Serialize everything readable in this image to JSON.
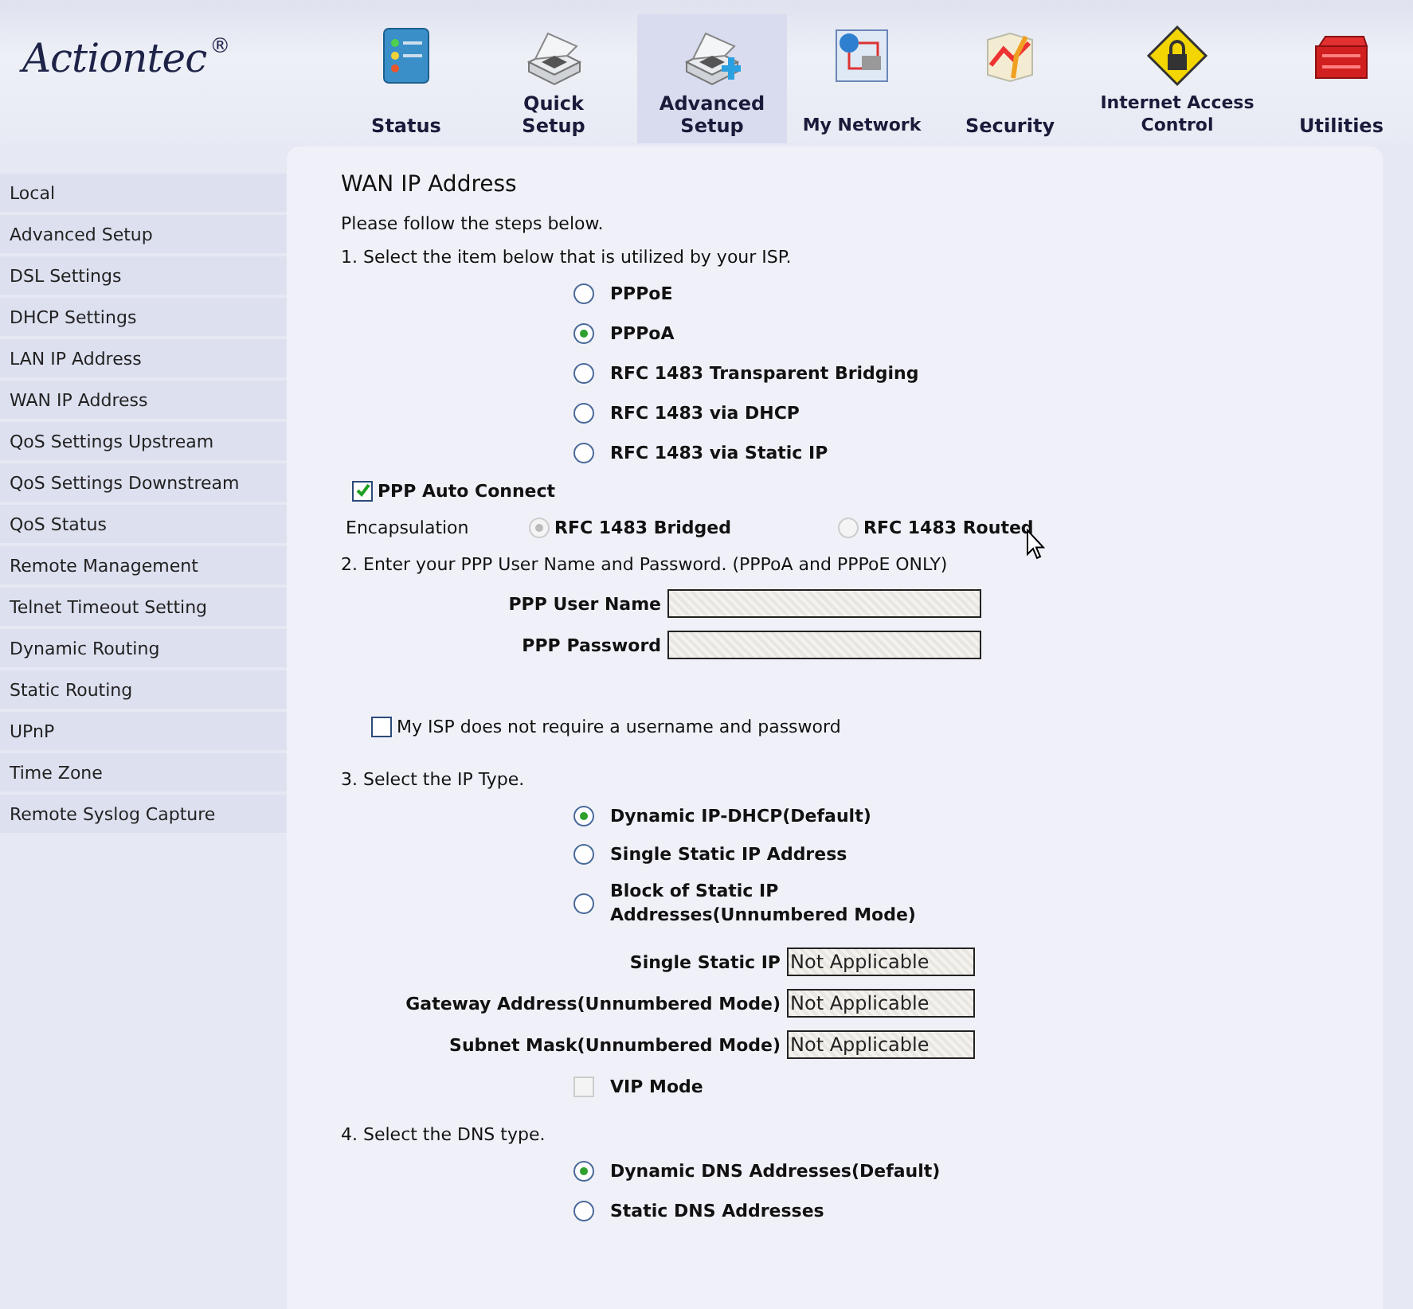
{
  "logo": {
    "text": "Actiontec",
    "mark": "®"
  },
  "nav": [
    {
      "label": "Status",
      "selected": false
    },
    {
      "label": "Quick Setup",
      "selected": false
    },
    {
      "label": "Advanced Setup",
      "selected": true
    },
    {
      "label": "My Network",
      "selected": false
    },
    {
      "label": "Security",
      "selected": false
    },
    {
      "label": "Internet Access Control",
      "selected": false
    },
    {
      "label": "Utilities",
      "selected": false
    }
  ],
  "sidebar": {
    "items": [
      {
        "label": "Local",
        "selected": false
      },
      {
        "label": "Advanced Setup",
        "selected": false
      },
      {
        "label": "DSL Settings",
        "selected": false
      },
      {
        "label": "DHCP Settings",
        "selected": false
      },
      {
        "label": "LAN IP Address",
        "selected": false
      },
      {
        "label": "WAN IP Address",
        "selected": false
      },
      {
        "label": "QoS Settings Upstream",
        "selected": false
      },
      {
        "label": "QoS Settings Downstream",
        "selected": false
      },
      {
        "label": "QoS Status",
        "selected": false
      },
      {
        "label": "Remote Management",
        "selected": false
      },
      {
        "label": "Telnet Timeout Setting",
        "selected": false
      },
      {
        "label": "Dynamic Routing",
        "selected": false
      },
      {
        "label": "Static Routing",
        "selected": false
      },
      {
        "label": "UPnP",
        "selected": false
      },
      {
        "label": "Time Zone",
        "selected": false
      },
      {
        "label": "Remote Syslog Capture",
        "selected": false
      }
    ]
  },
  "page": {
    "title": "WAN IP Address",
    "intro": "Please follow the steps below.",
    "step1": "1. Select the item below that is utilized by your ISP.",
    "isp_types": [
      {
        "label": "PPPoE",
        "selected": false
      },
      {
        "label": "PPPoA",
        "selected": true
      },
      {
        "label": "RFC 1483 Transparent Bridging",
        "selected": false
      },
      {
        "label": "RFC 1483 via DHCP",
        "selected": false
      },
      {
        "label": "RFC 1483 via Static IP",
        "selected": false
      }
    ],
    "auto_connect": {
      "label": "PPP Auto Connect",
      "checked": true
    },
    "encapsulation": {
      "label": "Encapsulation",
      "disabled": true,
      "options": [
        {
          "label": "RFC 1483 Bridged",
          "selected": true
        },
        {
          "label": "RFC 1483 Routed",
          "selected": false
        }
      ]
    },
    "step2": "2. Enter your PPP User Name and Password. (PPPoA and PPPoE ONLY)",
    "ppp_fields": [
      {
        "label": "PPP User Name",
        "disabled": true
      },
      {
        "label": "PPP Password",
        "disabled": true
      }
    ],
    "no_credentials": {
      "label": "My ISP does not require a username and password",
      "checked": false
    },
    "step3": "3. Select the IP Type.",
    "ip_types": [
      {
        "label": "Dynamic IP-DHCP(Default)",
        "selected": true
      },
      {
        "label": "Single Static IP Address",
        "selected": false
      },
      {
        "label": "Block of Static IP Addresses(Unnumbered Mode)",
        "selected": false
      }
    ],
    "ip_fields": [
      {
        "label": "Single Static IP",
        "value": "Not Applicable",
        "disabled": true
      },
      {
        "label": "Gateway Address(Unnumbered Mode)",
        "value": "Not Applicable",
        "disabled": true
      },
      {
        "label": "Subnet Mask(Unnumbered Mode)",
        "value": "Not Applicable",
        "disabled": true
      }
    ],
    "vip_mode": {
      "label": "VIP Mode",
      "checked": false,
      "disabled": true
    },
    "step4": "4. Select the DNS type.",
    "dns_types": [
      {
        "label": "Dynamic DNS Addresses(Default)",
        "selected": true
      },
      {
        "label": "Static DNS Addresses",
        "selected": false
      }
    ]
  }
}
